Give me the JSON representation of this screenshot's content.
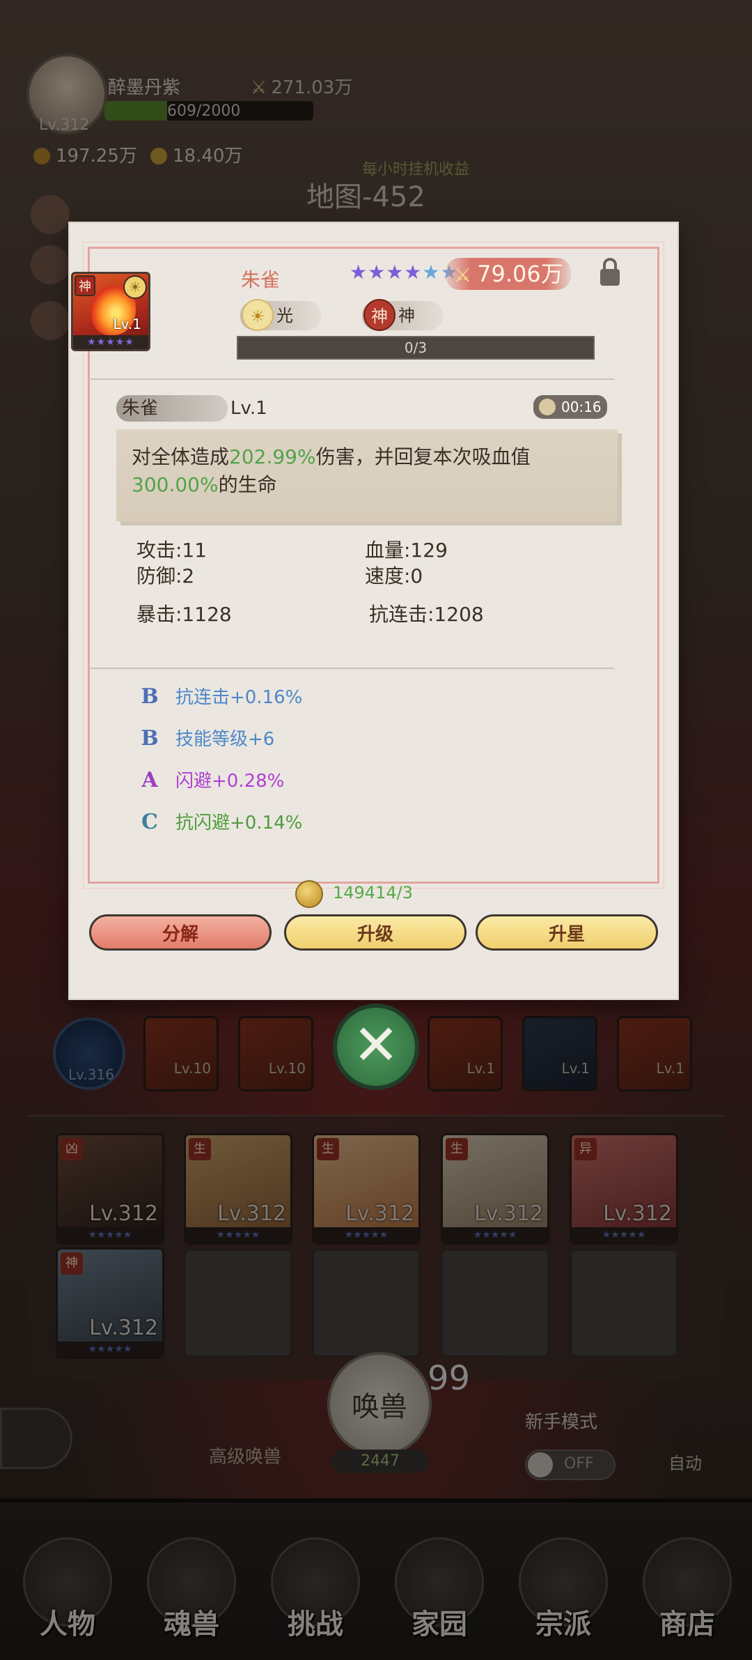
{
  "hud": {
    "player_name": "醉墨丹紫",
    "player_level": "Lv.312",
    "power": "271.03万",
    "exp": "609/2000",
    "exp_fraction": 0.3,
    "gold": "197.25万",
    "gems": "18.40万",
    "hourly_label": "每小时挂机收益",
    "map_title": "地图-452"
  },
  "pet": {
    "card_tag": "神",
    "card_level": "Lv.1",
    "name": "朱雀",
    "stars_filled": 4,
    "stars_total": 6,
    "power": "79.06万",
    "element": "光",
    "race": "神",
    "star_progress": "0/3",
    "star_progress_fraction": 0
  },
  "skill": {
    "name": "朱雀",
    "level": "Lv.1",
    "cooldown": "00:16",
    "desc_prefix": "对全体造成",
    "desc_val1": "202.99%",
    "desc_mid": "伤害，并回复本次吸血值",
    "desc_val2": "300.00%",
    "desc_suffix": "的生命"
  },
  "stats": {
    "attack": "攻击:11",
    "hp": "血量:129",
    "defense": "防御:2",
    "speed": "速度:0",
    "crit": "暴击:1128",
    "anti_combo": "抗连击:1208"
  },
  "bonuses": [
    {
      "grade": "B",
      "text": "抗连击+0.16%"
    },
    {
      "grade": "B",
      "text": "技能等级+6"
    },
    {
      "grade": "A",
      "text": "闪避+0.28%"
    },
    {
      "grade": "C",
      "text": "抗闪避+0.14%"
    }
  ],
  "cost": "149414/3",
  "buttons": {
    "decompose": "分解",
    "upgrade": "升级",
    "star_up": "升星"
  },
  "team": {
    "avatar_level": "Lv.316",
    "slot_levels": [
      "Lv.10",
      "Lv.10",
      "Lv.1",
      "Lv.1",
      "Lv.1"
    ]
  },
  "roster": [
    {
      "tag": "凶",
      "level": "Lv.312"
    },
    {
      "tag": "生",
      "level": "Lv.312"
    },
    {
      "tag": "生",
      "level": "Lv.312"
    },
    {
      "tag": "生",
      "level": "Lv.312"
    },
    {
      "tag": "异",
      "level": "Lv.312"
    },
    {
      "tag": "神",
      "level": "Lv.312"
    }
  ],
  "summon": {
    "label": "唤兽",
    "count": "99",
    "cost": "2447",
    "advanced_label": "高级唤兽",
    "newbie_mode": "新手模式",
    "toggle_state": "OFF",
    "auto_label": "自动"
  },
  "nav": [
    "人物",
    "魂兽",
    "挑战",
    "家园",
    "宗派",
    "商店"
  ],
  "colors": {
    "highlight_green": "#52a34a",
    "pet_name": "#d4725e",
    "grade_b": "#4d87c9",
    "grade_a": "#b03fd4",
    "grade_c": "#4f9c3c"
  }
}
